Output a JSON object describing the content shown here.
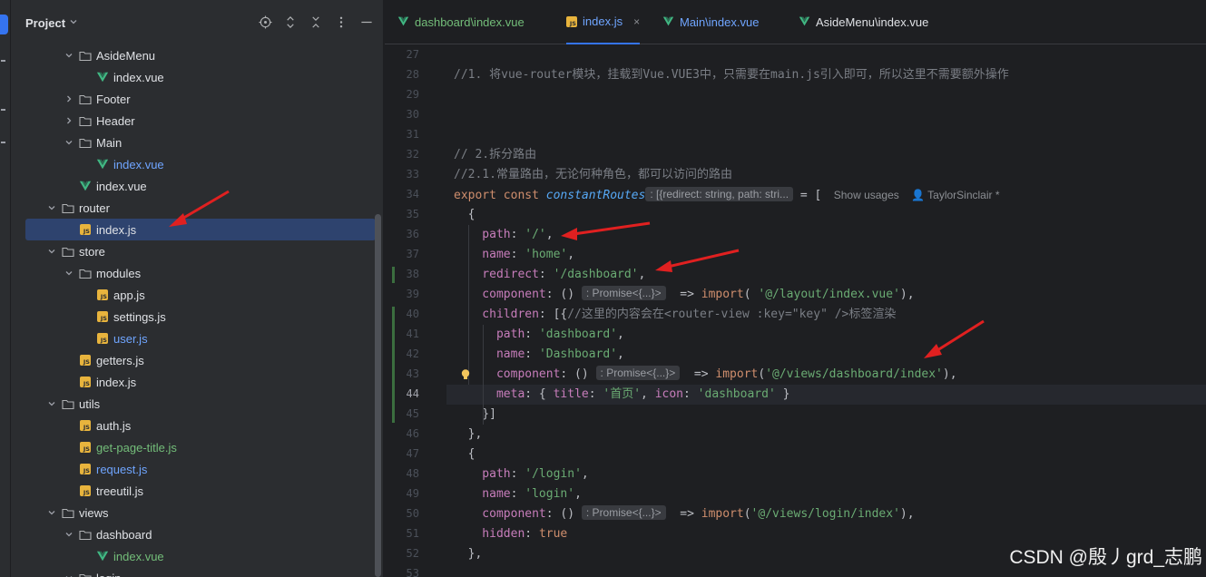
{
  "project_panel": {
    "title": "Project",
    "tree": [
      {
        "label": "AsideMenu",
        "type": "folder",
        "depth": 4,
        "expanded": true,
        "color": "default"
      },
      {
        "label": "index.vue",
        "type": "vue",
        "depth": 5,
        "color": "default"
      },
      {
        "label": "Footer",
        "type": "folder",
        "depth": 4,
        "expanded": false,
        "color": "default"
      },
      {
        "label": "Header",
        "type": "folder",
        "depth": 4,
        "expanded": false,
        "color": "default"
      },
      {
        "label": "Main",
        "type": "folder",
        "depth": 4,
        "expanded": true,
        "color": "default"
      },
      {
        "label": "index.vue",
        "type": "vue",
        "depth": 5,
        "color": "blue"
      },
      {
        "label": "index.vue",
        "type": "vue",
        "depth": 4,
        "color": "default"
      },
      {
        "label": "router",
        "type": "folder",
        "depth": 3,
        "expanded": true,
        "color": "default"
      },
      {
        "label": "index.js",
        "type": "js",
        "depth": 4,
        "color": "default",
        "selected": true
      },
      {
        "label": "store",
        "type": "folder",
        "depth": 3,
        "expanded": true,
        "color": "default"
      },
      {
        "label": "modules",
        "type": "folder",
        "depth": 4,
        "expanded": true,
        "color": "default"
      },
      {
        "label": "app.js",
        "type": "js",
        "depth": 5,
        "color": "default"
      },
      {
        "label": "settings.js",
        "type": "js",
        "depth": 5,
        "color": "default"
      },
      {
        "label": "user.js",
        "type": "js",
        "depth": 5,
        "color": "blue"
      },
      {
        "label": "getters.js",
        "type": "js",
        "depth": 4,
        "color": "default"
      },
      {
        "label": "index.js",
        "type": "js",
        "depth": 4,
        "color": "default"
      },
      {
        "label": "utils",
        "type": "folder",
        "depth": 3,
        "expanded": true,
        "color": "default"
      },
      {
        "label": "auth.js",
        "type": "js",
        "depth": 4,
        "color": "default"
      },
      {
        "label": "get-page-title.js",
        "type": "js",
        "depth": 4,
        "color": "green"
      },
      {
        "label": "request.js",
        "type": "js",
        "depth": 4,
        "color": "blue"
      },
      {
        "label": "treeutil.js",
        "type": "js",
        "depth": 4,
        "color": "default"
      },
      {
        "label": "views",
        "type": "folder",
        "depth": 3,
        "expanded": true,
        "color": "default"
      },
      {
        "label": "dashboard",
        "type": "folder",
        "depth": 4,
        "expanded": true,
        "color": "default"
      },
      {
        "label": "index.vue",
        "type": "vue",
        "depth": 5,
        "color": "green"
      },
      {
        "label": "login",
        "type": "folder",
        "depth": 4,
        "expanded": true,
        "color": "default"
      }
    ]
  },
  "tabs": [
    {
      "label": "dashboard\\index.vue",
      "icon": "vue",
      "color": "green",
      "active": false
    },
    {
      "label": "index.js",
      "icon": "js",
      "color": "blue",
      "active": true,
      "close": "×"
    },
    {
      "label": "Main\\index.vue",
      "icon": "vue",
      "color": "blue",
      "active": false
    },
    {
      "label": "AsideMenu\\index.vue",
      "icon": "vue",
      "color": "plain",
      "active": false
    }
  ],
  "editor": {
    "first_line": 27,
    "current_line": 44,
    "lines": [
      [],
      [
        [
          "cm",
          "//1. 将vue-router模块，挂载到Vue.VUE3中，只需要在main.js引入即可，所以这里不需要额外操作"
        ]
      ],
      [],
      [],
      [],
      [
        [
          "cm",
          "// 2.拆分路由"
        ]
      ],
      [
        [
          "cm",
          "//2.1.常量路由，无论何种角色，都可以访问的路由"
        ]
      ],
      [
        [
          "kw",
          "export const "
        ],
        [
          "fn",
          "constantRoutes"
        ],
        [
          "hint",
          ": [{redirect: string, path: stri..."
        ],
        [
          "ident",
          " = ["
        ],
        [
          "meta",
          "    Show usages    👤 TaylorSinclair *"
        ]
      ],
      [
        [
          "ident",
          "  {"
        ]
      ],
      [
        [
          "prop",
          "    path"
        ],
        [
          "ident",
          ": "
        ],
        [
          "str",
          "'/'"
        ],
        [
          "ident",
          ","
        ]
      ],
      [
        [
          "prop",
          "    name"
        ],
        [
          "ident",
          ": "
        ],
        [
          "str",
          "'home'"
        ],
        [
          "ident",
          ","
        ]
      ],
      [
        [
          "prop",
          "    redirect"
        ],
        [
          "ident",
          ": "
        ],
        [
          "str",
          "'/dashboard'"
        ],
        [
          "ident",
          ","
        ]
      ],
      [
        [
          "prop",
          "    component"
        ],
        [
          "ident",
          ": () "
        ],
        [
          "hint",
          ": Promise<{...}>"
        ],
        [
          "ident",
          "  => "
        ],
        [
          "kw",
          "import"
        ],
        [
          "ident",
          "( "
        ],
        [
          "str",
          "'@/layout/index.vue'"
        ],
        [
          "ident",
          "),"
        ]
      ],
      [
        [
          "prop",
          "    children"
        ],
        [
          "ident",
          ": [{"
        ],
        [
          "cm",
          "//这里的内容会在<router-view :key=\"key\" />标签渲染"
        ]
      ],
      [
        [
          "prop",
          "      path"
        ],
        [
          "ident",
          ": "
        ],
        [
          "str",
          "'dashboard'"
        ],
        [
          "ident",
          ","
        ]
      ],
      [
        [
          "prop",
          "      name"
        ],
        [
          "ident",
          ": "
        ],
        [
          "str",
          "'Dashboard'"
        ],
        [
          "ident",
          ","
        ]
      ],
      [
        [
          "prop",
          "      component"
        ],
        [
          "ident",
          ": () "
        ],
        [
          "hint",
          ": Promise<{...}>"
        ],
        [
          "ident",
          "  => "
        ],
        [
          "kw",
          "import"
        ],
        [
          "ident",
          "("
        ],
        [
          "str",
          "'@/views/dashboard/index'"
        ],
        [
          "ident",
          "),"
        ]
      ],
      [
        [
          "prop",
          "      meta"
        ],
        [
          "ident",
          ": { "
        ],
        [
          "prop",
          "title"
        ],
        [
          "ident",
          ": "
        ],
        [
          "str",
          "'首页'"
        ],
        [
          "ident",
          ", "
        ],
        [
          "prop",
          "icon"
        ],
        [
          "ident",
          ": "
        ],
        [
          "str",
          "'dashboard'"
        ],
        [
          "ident",
          " }"
        ]
      ],
      [
        [
          "ident",
          "    }]"
        ]
      ],
      [
        [
          "ident",
          "  },"
        ]
      ],
      [
        [
          "ident",
          "  {"
        ]
      ],
      [
        [
          "prop",
          "    path"
        ],
        [
          "ident",
          ": "
        ],
        [
          "str",
          "'/login'"
        ],
        [
          "ident",
          ","
        ]
      ],
      [
        [
          "prop",
          "    name"
        ],
        [
          "ident",
          ": "
        ],
        [
          "str",
          "'login'"
        ],
        [
          "ident",
          ","
        ]
      ],
      [
        [
          "prop",
          "    component"
        ],
        [
          "ident",
          ": () "
        ],
        [
          "hint",
          ": Promise<{...}>"
        ],
        [
          "ident",
          "  => "
        ],
        [
          "kw",
          "import"
        ],
        [
          "ident",
          "("
        ],
        [
          "str",
          "'@/views/login/index'"
        ],
        [
          "ident",
          "),"
        ]
      ],
      [
        [
          "prop",
          "    hidden"
        ],
        [
          "ident",
          ": "
        ],
        [
          "kw",
          "true"
        ]
      ],
      [
        [
          "ident",
          "  },"
        ]
      ],
      []
    ]
  },
  "watermark": "CSDN @殷丿grd_志鹏",
  "colors": {
    "accent": "#3574f0",
    "selection": "#2e436e",
    "annotation_arrow": "#e02020"
  }
}
